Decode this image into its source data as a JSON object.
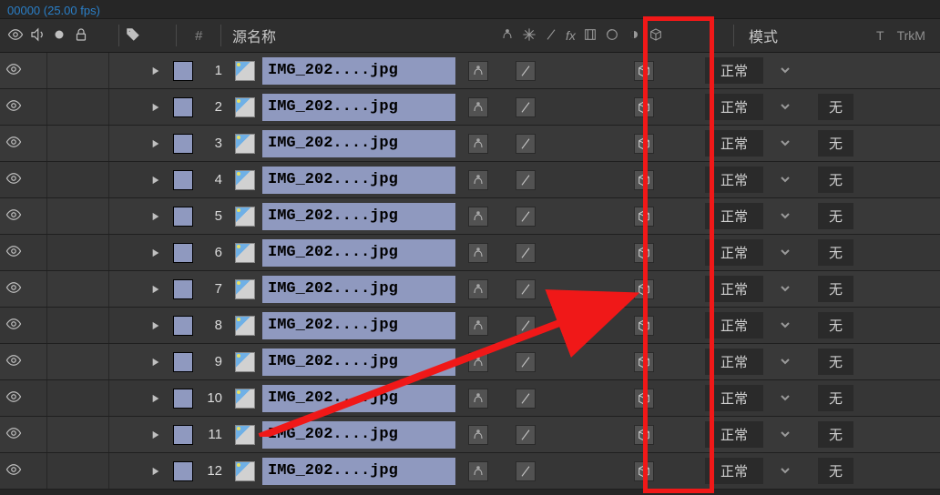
{
  "top_info": "00000 (25.00 fps)",
  "header": {
    "source_name": "源名称",
    "mode_label": "模式",
    "trk_t": "T",
    "trk_m": "TrkM"
  },
  "mode_value": "正常",
  "track_matte_value": "无",
  "layers": [
    {
      "idx": 1,
      "name": "IMG_202....jpg",
      "show_trk": false
    },
    {
      "idx": 2,
      "name": "IMG_202....jpg",
      "show_trk": true
    },
    {
      "idx": 3,
      "name": "IMG_202....jpg",
      "show_trk": true
    },
    {
      "idx": 4,
      "name": "IMG_202....jpg",
      "show_trk": true
    },
    {
      "idx": 5,
      "name": "IMG_202....jpg",
      "show_trk": true
    },
    {
      "idx": 6,
      "name": "IMG_202....jpg",
      "show_trk": true
    },
    {
      "idx": 7,
      "name": "IMG_202....jpg",
      "show_trk": true
    },
    {
      "idx": 8,
      "name": "IMG_202....jpg",
      "show_trk": true
    },
    {
      "idx": 9,
      "name": "IMG_202....jpg",
      "show_trk": true
    },
    {
      "idx": 10,
      "name": "IMG_202....jpg",
      "show_trk": true
    },
    {
      "idx": 11,
      "name": "IMG_202....jpg",
      "show_trk": true
    },
    {
      "idx": 12,
      "name": "IMG_202....jpg",
      "show_trk": true
    }
  ]
}
